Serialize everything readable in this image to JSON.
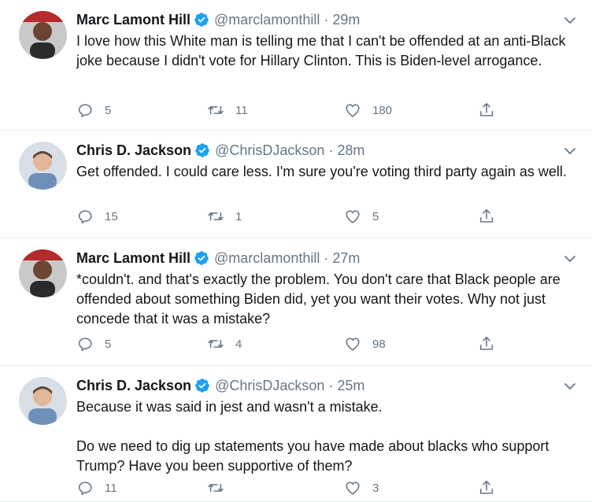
{
  "tweets": [
    {
      "name": "Marc Lamont Hill",
      "handle": "@marclamonthill",
      "sep": "·",
      "time": "29m",
      "text": "I love how this White man is telling me that I can't be offended at an anti-Black joke because I didn't vote for Hillary Clinton. This is Biden-level arrogance.",
      "reply_count": "5",
      "retweet_count": "11",
      "like_count": "180"
    },
    {
      "name": "Chris D. Jackson",
      "handle": "@ChrisDJackson",
      "sep": "·",
      "time": "28m",
      "text": "Get offended. I could care less. I'm sure you're voting third party again as well.",
      "reply_count": "15",
      "retweet_count": "1",
      "like_count": "5"
    },
    {
      "name": "Marc Lamont Hill",
      "handle": "@marclamonthill",
      "sep": "·",
      "time": "27m",
      "text": "*couldn't. and that's exactly the problem. You don't care that Black people are offended about something Biden did, yet you want their votes. Why not just concede that it was a mistake?",
      "reply_count": "5",
      "retweet_count": "4",
      "like_count": "98"
    },
    {
      "name": "Chris D. Jackson",
      "handle": "@ChrisDJackson",
      "sep": "·",
      "time": "25m",
      "text": "Because it was said in jest and wasn't a mistake.\n\nDo we need to dig up statements you have made about blacks who support Trump? Have you been supportive of them?",
      "reply_count": "11",
      "retweet_count": "",
      "like_count": "3"
    }
  ],
  "colors": {
    "verified": "#1da1f2",
    "muted": "#657786",
    "divider": "#e6ecf0",
    "text": "#14171a"
  },
  "icons": [
    "reply-icon",
    "retweet-icon",
    "like-icon",
    "share-icon",
    "verified-badge-icon",
    "chevron-down-icon"
  ]
}
